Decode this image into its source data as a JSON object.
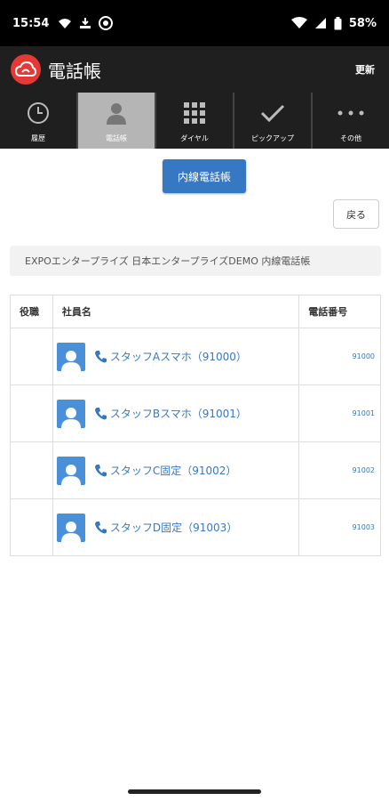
{
  "status": {
    "time": "15:54",
    "battery": "58%"
  },
  "app": {
    "title": "電話帳",
    "refresh_label": "更新"
  },
  "tabs": [
    {
      "label": "履歴",
      "icon": "clock-icon",
      "active": false
    },
    {
      "label": "電話帳",
      "icon": "person-icon",
      "active": true
    },
    {
      "label": "ダイヤル",
      "icon": "dialpad-icon",
      "active": false
    },
    {
      "label": "ピックアップ",
      "icon": "check-icon",
      "active": false
    },
    {
      "label": "その他",
      "icon": "more-icon",
      "active": false
    }
  ],
  "main": {
    "directory_button": "内線電話帳",
    "back_button": "戻る",
    "breadcrumb": "EXPOエンタープライズ 日本エンタープライズDEMO 内線電話帳",
    "table": {
      "headers": [
        "役職",
        "社員名",
        "電話番号"
      ],
      "rows": [
        {
          "role": "",
          "name": "スタッフAスマホ（91000）",
          "number": "91000"
        },
        {
          "role": "",
          "name": "スタッフBスマホ（91001）",
          "number": "91001"
        },
        {
          "role": "",
          "name": "スタッフC固定（91002）",
          "number": "91002"
        },
        {
          "role": "",
          "name": "スタッフD固定（91003）",
          "number": "91003"
        }
      ]
    }
  },
  "colors": {
    "accent": "#3778c2",
    "logo": "#e53935",
    "appbar": "#1f1f1f",
    "active_tab": "#b5b5b5"
  }
}
